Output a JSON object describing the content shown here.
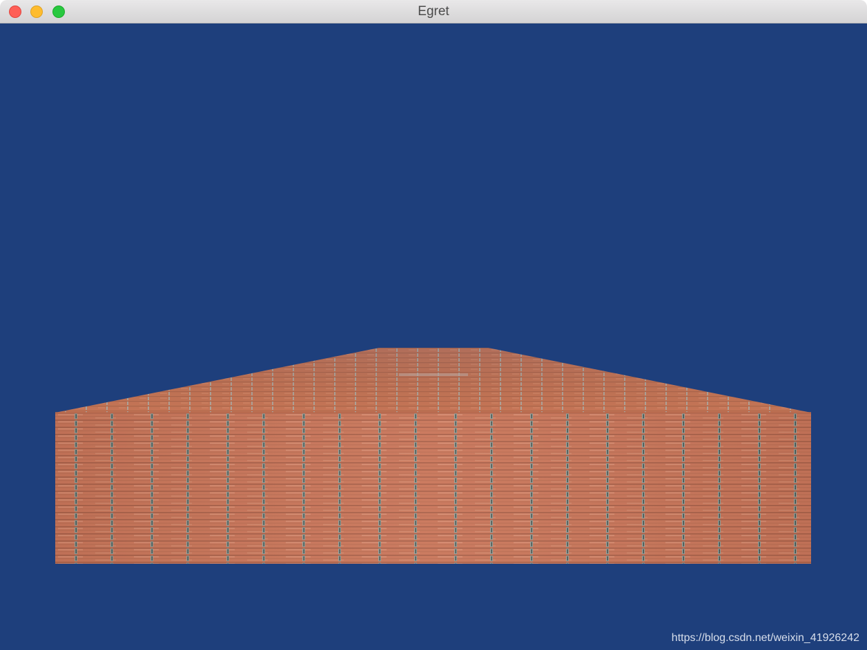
{
  "window": {
    "title": "Egret"
  },
  "scene": {
    "background_color": "#1e3f7c",
    "object": "brick-textured box",
    "brick_color": "#c9765a",
    "mortar_color": "#8e9a95"
  },
  "watermark": {
    "text": "https://blog.csdn.net/weixin_41926242"
  }
}
